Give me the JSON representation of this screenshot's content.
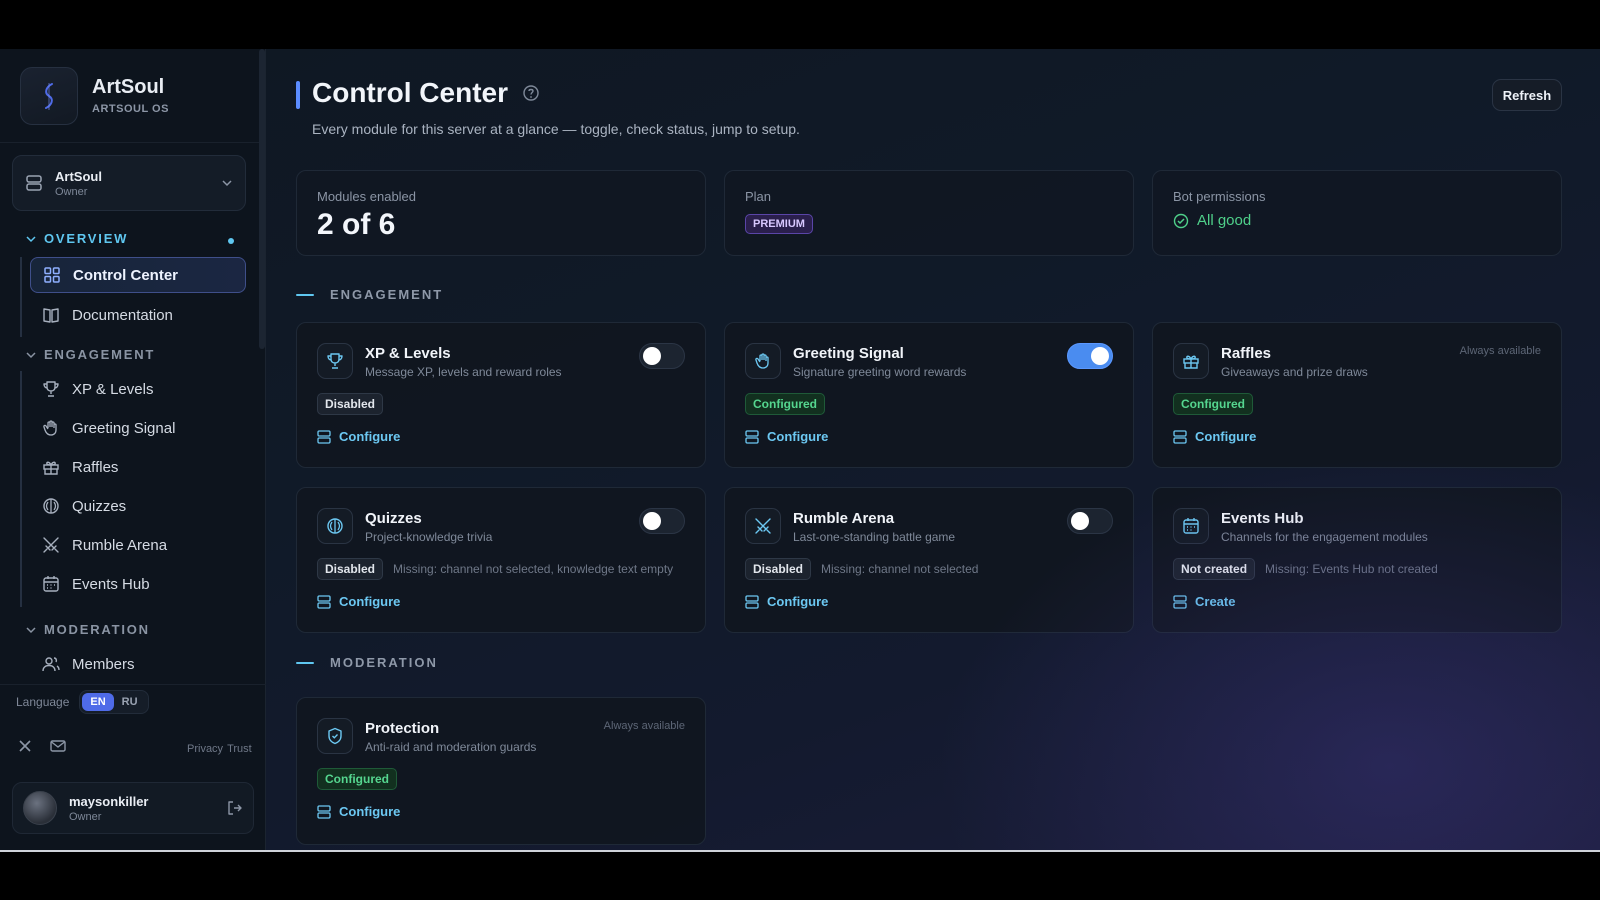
{
  "brand": {
    "name": "ArtSoul",
    "sub": "ARTSOUL OS"
  },
  "server": {
    "name": "ArtSoul",
    "role": "Owner"
  },
  "nav": {
    "overview_label": "OVERVIEW",
    "engagement_label": "ENGAGEMENT",
    "moderation_label": "MODERATION",
    "items": {
      "control_center": "Control Center",
      "documentation": "Documentation",
      "xp_levels": "XP & Levels",
      "greeting_signal": "Greeting Signal",
      "raffles": "Raffles",
      "quizzes": "Quizzes",
      "rumble_arena": "Rumble Arena",
      "events_hub": "Events Hub",
      "members": "Members"
    }
  },
  "language": {
    "label": "Language",
    "options": [
      "EN",
      "RU"
    ],
    "selected": "EN"
  },
  "legal": {
    "privacy": "Privacy",
    "trust": "Trust"
  },
  "user": {
    "name": "maysonkiller",
    "role": "Owner"
  },
  "page": {
    "title": "Control Center",
    "subtitle": "Every module for this server at a glance — toggle, check status, jump to setup.",
    "refresh_label": "Refresh"
  },
  "stats": {
    "modules_label": "Modules enabled",
    "modules_value": "2 of 6",
    "plan_label": "Plan",
    "plan_value": "PREMIUM",
    "perms_label": "Bot permissions",
    "perms_value": "All good"
  },
  "sections": {
    "engagement": "ENGAGEMENT",
    "moderation": "MODERATION"
  },
  "cards": {
    "xp": {
      "title": "XP & Levels",
      "desc": "Message XP, levels and reward roles",
      "status": "Disabled",
      "action": "Configure",
      "enabled": false
    },
    "greeting": {
      "title": "Greeting Signal",
      "desc": "Signature greeting word rewards",
      "status": "Configured",
      "action": "Configure",
      "enabled": true
    },
    "raffles": {
      "title": "Raffles",
      "desc": "Giveaways and prize draws",
      "status": "Configured",
      "action": "Configure",
      "note": "Always available"
    },
    "quizzes": {
      "title": "Quizzes",
      "desc": "Project-knowledge trivia",
      "status": "Disabled",
      "missing": "Missing: channel not selected, knowledge text empty",
      "action": "Configure",
      "enabled": false
    },
    "rumble": {
      "title": "Rumble Arena",
      "desc": "Last-one-standing battle game",
      "status": "Disabled",
      "missing": "Missing: channel not selected",
      "action": "Configure",
      "enabled": false
    },
    "events": {
      "title": "Events Hub",
      "desc": "Channels for the engagement modules",
      "status": "Not created",
      "missing": "Missing: Events Hub not created",
      "action": "Create"
    },
    "protection": {
      "title": "Protection",
      "desc": "Anti-raid and moderation guards",
      "status": "Configured",
      "action": "Configure",
      "note": "Always available"
    }
  },
  "colors": {
    "accent": "#5fc7f0",
    "toggle_on": "#4a8cf0",
    "configured": "#55d68f",
    "premium": "#5a45a8",
    "background": "#101a28"
  },
  "icons": [
    "help-circle-icon",
    "trophy-icon",
    "hand-icon",
    "gift-icon",
    "bulb-icon",
    "swords-icon",
    "calendar-icon",
    "shield-icon",
    "layout-grid-icon",
    "book-icon",
    "users-icon",
    "server-icon",
    "chevron-down-icon",
    "x-logo-icon",
    "mail-icon",
    "logout-icon",
    "check-circle-icon"
  ]
}
